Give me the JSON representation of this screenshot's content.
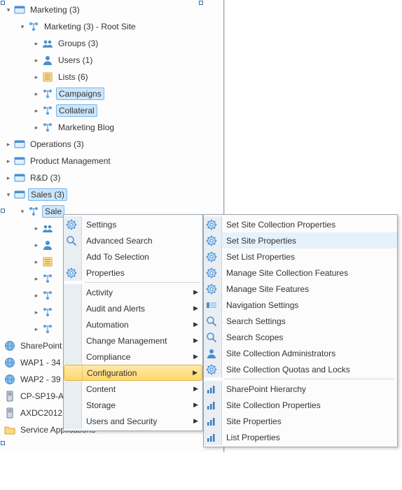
{
  "tree": {
    "marketing": "Marketing (3)",
    "marketing_root": "Marketing (3) - Root Site",
    "groups": "Groups (3)",
    "users": "Users (1)",
    "lists": "Lists (6)",
    "campaigns": "Campaigns",
    "collateral": "Collateral",
    "marketing_blog": "Marketing Blog",
    "operations": "Operations (3)",
    "product_mgmt": "Product Management",
    "rnd": "R&D (3)",
    "sales": "Sales (3)",
    "sales_sub": "Sale",
    "sharepoint": "SharePoint",
    "wap1": "WAP1 - 34",
    "wap2": "WAP2 - 39",
    "cp": "CP-SP19-A",
    "ax": "AXDC2012",
    "service_apps": "Service Applications"
  },
  "menu1": {
    "settings": "Settings",
    "advanced_search": "Advanced Search",
    "add_to_selection": "Add To Selection",
    "properties": "Properties",
    "activity": "Activity",
    "audit_alerts": "Audit and Alerts",
    "automation": "Automation",
    "change_mgmt": "Change Management",
    "compliance": "Compliance",
    "configuration": "Configuration",
    "content": "Content",
    "storage": "Storage",
    "users_security": "Users and Security"
  },
  "menu2": {
    "set_site_coll_props": "Set Site Collection Properties",
    "set_site_props": "Set Site Properties",
    "set_list_props": "Set List Properties",
    "manage_site_coll_features": "Manage Site Collection Features",
    "manage_site_features": "Manage Site Features",
    "navigation_settings": "Navigation Settings",
    "search_settings": "Search Settings",
    "search_scopes": "Search Scopes",
    "site_coll_admins": "Site Collection Administrators",
    "site_coll_quotas": "Site Collection Quotas and Locks",
    "sp_hierarchy": "SharePoint Hierarchy",
    "site_coll_props": "Site Collection Properties",
    "site_props": "Site Properties",
    "list_props": "List Properties"
  }
}
